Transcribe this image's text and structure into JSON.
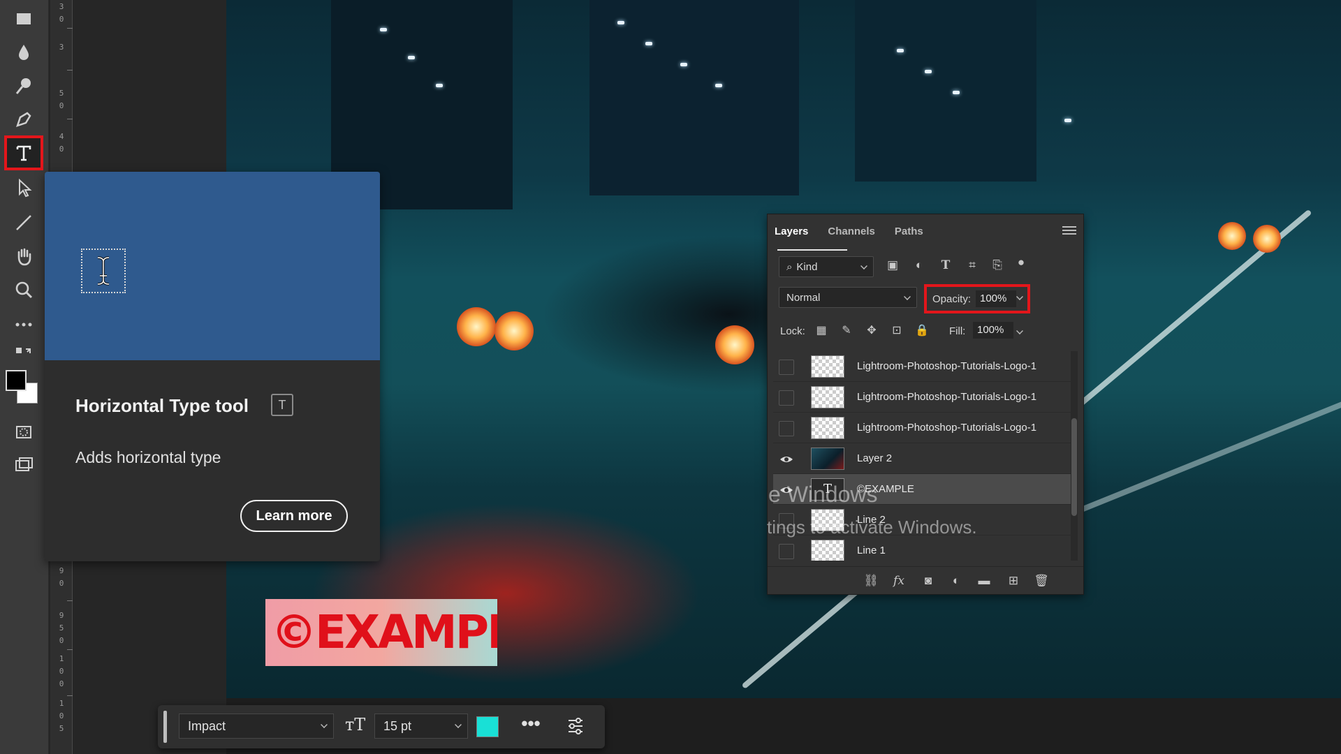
{
  "toolbar": {
    "tools": [
      "rectangle-tool",
      "blur-tool",
      "dodge-tool",
      "pen-tool",
      "horizontal-type-tool",
      "path-selection-tool",
      "line-tool",
      "hand-tool",
      "zoom-tool",
      "more-tools"
    ],
    "active_tool": "horizontal-type-tool",
    "highlight_color": "#e3161b"
  },
  "ruler": {
    "numbers": [
      "3",
      "0",
      "3",
      "5",
      "0",
      "4",
      "0",
      "9",
      "0",
      "9",
      "5",
      "0",
      "1",
      "0",
      "0",
      "1",
      "0",
      "5"
    ]
  },
  "tooltip": {
    "title": "Horizontal Type tool",
    "shortcut": "T",
    "description": "Adds horizontal type",
    "learn_more": "Learn more",
    "preview_color": "#2f5a8e"
  },
  "canvas": {
    "text_layer": "©EXAMPLE",
    "text_color": "#e0101a"
  },
  "layers_panel": {
    "tabs": [
      "Layers",
      "Channels",
      "Paths"
    ],
    "active_tab": "Layers",
    "filter": {
      "label": "Kind"
    },
    "blend_mode": "Normal",
    "opacity": {
      "label": "Opacity:",
      "value": "100%"
    },
    "lock": {
      "label": "Lock:"
    },
    "fill": {
      "label": "Fill:",
      "value": "100%"
    },
    "layers": [
      {
        "name": "Lightroom-Photoshop-Tutorials-Logo-1",
        "visible": false,
        "thumb": "checker",
        "selected": false
      },
      {
        "name": "Lightroom-Photoshop-Tutorials-Logo-1",
        "visible": false,
        "thumb": "checker",
        "selected": false
      },
      {
        "name": "Lightroom-Photoshop-Tutorials-Logo-1",
        "visible": false,
        "thumb": "checker",
        "selected": false
      },
      {
        "name": "Layer 2",
        "visible": true,
        "thumb": "photo",
        "selected": false
      },
      {
        "name": "©EXAMPLE",
        "visible": true,
        "thumb": "text",
        "selected": true
      },
      {
        "name": "Line 2",
        "visible": false,
        "thumb": "checker",
        "selected": false
      },
      {
        "name": "Line 1",
        "visible": false,
        "thumb": "checker",
        "selected": false
      }
    ],
    "text_thumb_glyph": "T"
  },
  "watermark": {
    "line1": "e Windows",
    "line2": "tings to activate Windows."
  },
  "task_bar": {
    "font": "Impact",
    "size": "15 pt",
    "text_color": "#19e0d6",
    "more": "•••"
  }
}
